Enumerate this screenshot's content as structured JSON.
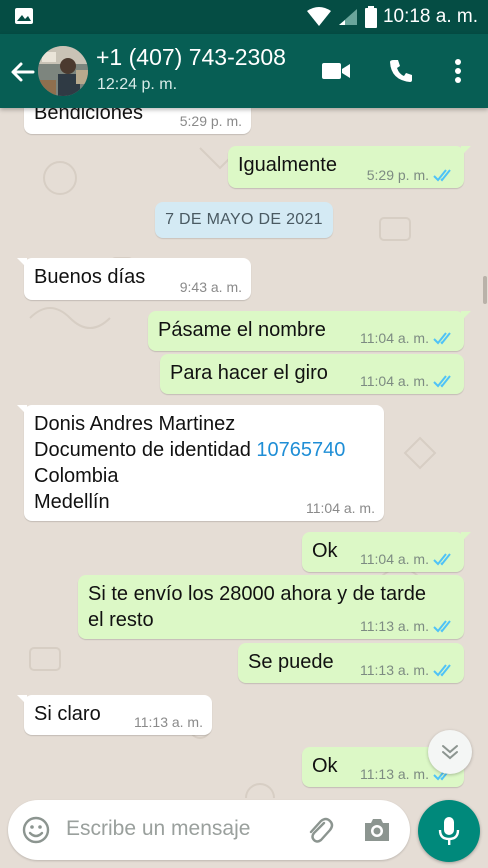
{
  "status_bar": {
    "time": "10:18 a. m.",
    "icons": [
      "gallery-icon",
      "wifi-icon",
      "signal-icon",
      "battery-icon"
    ]
  },
  "header": {
    "contact_name": "+1 (407) 743-2308",
    "last_seen": "12:24 p. m.",
    "icons": [
      "back-arrow-icon",
      "video-call-icon",
      "phone-call-icon",
      "more-options-icon"
    ]
  },
  "colors": {
    "header": "#075e54",
    "status_bar": "#054d44",
    "outgoing_bubble": "#dcf8c6",
    "incoming_bubble": "#ffffff",
    "read_ticks": "#4fc3f7",
    "fab": "#00897b",
    "link": "#1f8ed6"
  },
  "date_chip": "7 DE MAYO DE 2021",
  "messages": [
    {
      "dir": "in",
      "text": "Bendiciones",
      "time": "5:29 p. m."
    },
    {
      "dir": "out",
      "text": "Igualmente",
      "time": "5:29 p. m.",
      "status": "read"
    },
    {
      "dir": "in",
      "text": "Buenos días",
      "time": "9:43 a. m."
    },
    {
      "dir": "out",
      "text": "Pásame el nombre",
      "time": "11:04 a. m.",
      "status": "read"
    },
    {
      "dir": "out",
      "text": "Para hacer el giro",
      "time": "11:04 a. m.",
      "status": "read"
    },
    {
      "dir": "in",
      "lines": [
        "Donis Andres Martinez",
        "Documento de identidad",
        "10765740",
        "Colombia",
        "Medellín"
      ],
      "time": "11:04 a. m."
    },
    {
      "dir": "out",
      "text": "Ok",
      "time": "11:04 a. m.",
      "status": "read"
    },
    {
      "dir": "out",
      "lines": [
        "Si te envío los 28000 ahora y de tarde",
        "el resto"
      ],
      "time": "11:13 a. m.",
      "status": "read"
    },
    {
      "dir": "out",
      "text": "Se puede",
      "time": "11:13 a. m.",
      "status": "read"
    },
    {
      "dir": "in",
      "text": "Si claro",
      "time": "11:13 a. m."
    },
    {
      "dir": "out",
      "text": "Ok",
      "time": "11:13 a. m.",
      "status": "read"
    }
  ],
  "composer": {
    "placeholder": "Escribe un mensaje",
    "icons": [
      "emoji-icon",
      "attach-icon",
      "camera-icon",
      "mic-icon"
    ]
  }
}
